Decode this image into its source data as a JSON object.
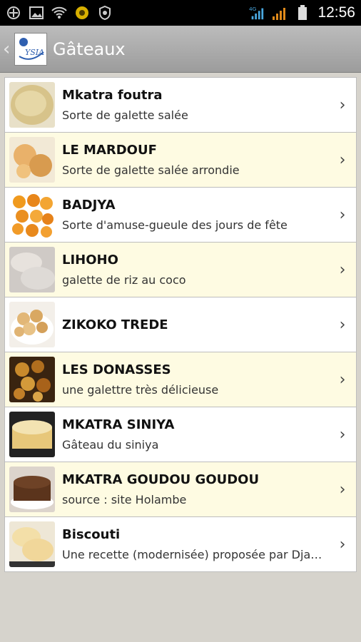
{
  "status_bar": {
    "time": "12:56",
    "left_icons": [
      "usb-icon",
      "image-icon",
      "wifi-icon",
      "app-badge-icon",
      "shield-icon"
    ],
    "right_icons": [
      "signal-4g-icon",
      "signal-icon",
      "battery-icon"
    ]
  },
  "header": {
    "logo_text": "YSIA",
    "title": "Gâteaux"
  },
  "items": [
    {
      "title": "Mkatra foutra",
      "subtitle": "Sorte de galette salée"
    },
    {
      "title": "LE MARDOUF",
      "subtitle": "Sorte de galette salée arrondie"
    },
    {
      "title": "BADJYA",
      "subtitle": "Sorte d'amuse-gueule des jours de fête"
    },
    {
      "title": "LIHOHO",
      "subtitle": "galette de riz au coco"
    },
    {
      "title": "ZIKOKO TREDE",
      "subtitle": ""
    },
    {
      "title": "LES DONASSES",
      "subtitle": "une galettre très délicieuse"
    },
    {
      "title": "MKATRA SINIYA",
      "subtitle": "Gâteau du siniya"
    },
    {
      "title": "MKATRA GOUDOU GOUDOU",
      "subtitle": "source : site Holambe"
    },
    {
      "title": "Biscouti",
      "subtitle": "Une recette (modernisée) proposée par Dja…"
    }
  ],
  "colors": {
    "row_odd": "#ffffff",
    "row_even": "#fefbe2",
    "action_bar": "#a8a8a8",
    "background": "#d6d3cc"
  }
}
